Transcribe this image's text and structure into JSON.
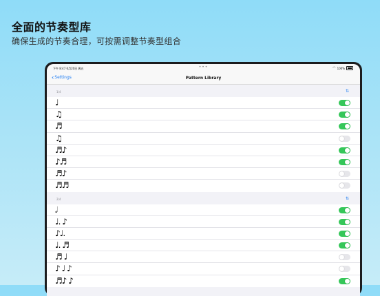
{
  "promo": {
    "title": "全面的节奏型库",
    "subtitle": "确保生成的节奏合理，可按需调整节奏型组合"
  },
  "status_bar": {
    "time": "下午 8:47   6月20日 周五",
    "battery": "100%"
  },
  "nav": {
    "back_label": "Settings",
    "title": "Pattern Library"
  },
  "colors": {
    "toggle_on": "#35c759",
    "toggle_off": "#e6e6ea",
    "accent": "#1e7cf2"
  },
  "sections": [
    {
      "label": "1/4",
      "rows": [
        {
          "pattern": "♩",
          "enabled": true
        },
        {
          "pattern": "♫",
          "enabled": true
        },
        {
          "pattern": "♬",
          "enabled": true
        },
        {
          "pattern": "♫",
          "enabled": false
        },
        {
          "pattern": "♬♪",
          "enabled": true
        },
        {
          "pattern": "♪♬",
          "enabled": true
        },
        {
          "pattern": "♬♪",
          "enabled": false
        },
        {
          "pattern": "♬♬",
          "enabled": false
        }
      ]
    },
    {
      "label": "2/4",
      "rows": [
        {
          "pattern": "𝅗𝅥",
          "enabled": true
        },
        {
          "pattern": "♩. ♪",
          "enabled": true
        },
        {
          "pattern": "♪♩.",
          "enabled": true
        },
        {
          "pattern": "♩. ♬",
          "enabled": true
        },
        {
          "pattern": "♬ ♩",
          "enabled": false
        },
        {
          "pattern": "♪ ♩ ♪",
          "enabled": false
        },
        {
          "pattern": "♬♪ ♪",
          "enabled": true
        }
      ]
    }
  ]
}
